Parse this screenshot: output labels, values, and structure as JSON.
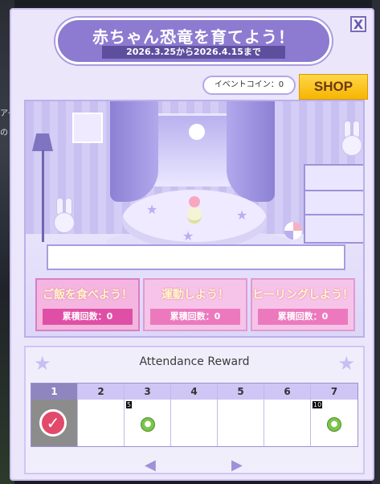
{
  "background": {
    "left_text_1": "アイ",
    "left_text_2": "の"
  },
  "header": {
    "title": "赤ちゃん恐竜を育てよう！",
    "period": "2026.3.25から2026.4.15まで",
    "close_label": "X"
  },
  "coins": {
    "label": "イベントコイン：0"
  },
  "shop": {
    "label": "SHOP"
  },
  "actions": [
    {
      "label": "ご飯を食べよう！",
      "count_label": "累積回数：0"
    },
    {
      "label": "運動しよう！",
      "count_label": "累積回数：0"
    },
    {
      "label": "ヒーリングしよう！",
      "count_label": "累積回数：0"
    }
  ],
  "attendance": {
    "title": "Attendance Reward",
    "days": [
      {
        "day": "1",
        "reward": "check",
        "qty": ""
      },
      {
        "day": "2",
        "reward": "",
        "qty": ""
      },
      {
        "day": "3",
        "reward": "coin",
        "qty": "5"
      },
      {
        "day": "4",
        "reward": "",
        "qty": ""
      },
      {
        "day": "5",
        "reward": "",
        "qty": ""
      },
      {
        "day": "6",
        "reward": "",
        "qty": ""
      },
      {
        "day": "7",
        "reward": "coin",
        "qty": "10"
      }
    ],
    "selected_day": "1",
    "prev_icon": "arrow-left-icon",
    "next_icon": "arrow-right-icon"
  },
  "colors": {
    "accent": "#8c7bd0",
    "shop": "#f7b500",
    "action_pink": "#e04fa6"
  }
}
